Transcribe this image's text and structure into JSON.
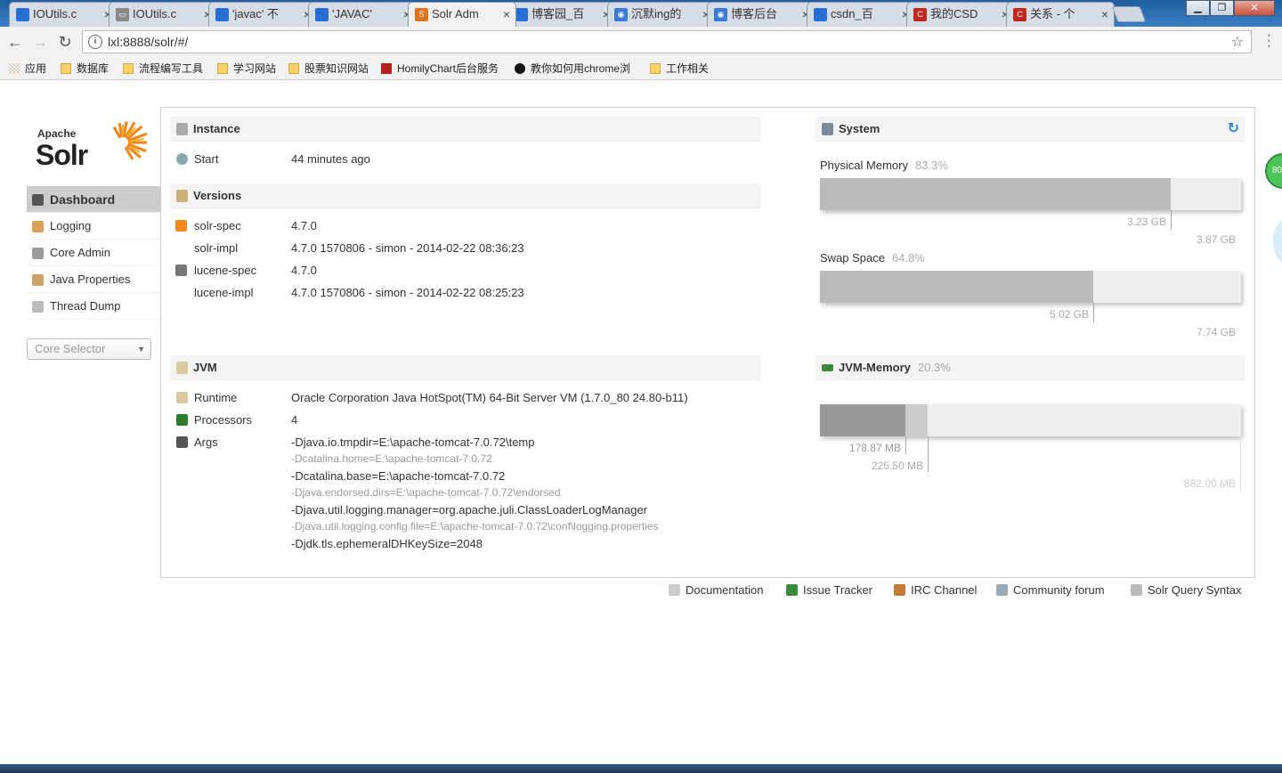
{
  "browser": {
    "tabs": [
      {
        "label": "IOUtils.c",
        "color": "#2a6fd6",
        "glyph": "🐾"
      },
      {
        "label": "IOUtils.c",
        "color": "#888888",
        "glyph": "▭"
      },
      {
        "label": "'javac' 不",
        "color": "#2a6fd6",
        "glyph": "🐾"
      },
      {
        "label": "'JAVAC'",
        "color": "#2a6fd6",
        "glyph": "🐾"
      },
      {
        "label": "Solr Adm",
        "color": "#e0741a",
        "glyph": "S"
      },
      {
        "label": "博客园_百",
        "color": "#2a6fd6",
        "glyph": "🐾"
      },
      {
        "label": "沉默ing的",
        "color": "#3a7bd5",
        "glyph": "◉"
      },
      {
        "label": "博客后台",
        "color": "#3a7bd5",
        "glyph": "◉"
      },
      {
        "label": "csdn_百",
        "color": "#2a6fd6",
        "glyph": "🐾"
      },
      {
        "label": "我的CSD",
        "color": "#c0281e",
        "glyph": "C"
      },
      {
        "label": "关系 - 个",
        "color": "#c0281e",
        "glyph": "C"
      }
    ],
    "tab_close": "×",
    "window_buttons": [
      "▁",
      "❐",
      "✕"
    ],
    "address": "lxl:8888/solr/#/",
    "info_glyph": "i",
    "star_glyph": "☆",
    "bookmarks": [
      {
        "label": "应用",
        "icon": "apps"
      },
      {
        "label": "数据库",
        "icon": "folder"
      },
      {
        "label": "流程编写工具",
        "icon": "folder"
      },
      {
        "label": "学习网站",
        "icon": "folder"
      },
      {
        "label": "股票知识网站",
        "icon": "folder"
      },
      {
        "label": "HomilyChart后台服务",
        "icon": "red"
      },
      {
        "label": "教你如何用chrome浏",
        "icon": "cblack"
      },
      {
        "label": "工作相关",
        "icon": "folder"
      }
    ]
  },
  "logo": {
    "apache": "Apache",
    "solr": "Solr"
  },
  "nav": [
    {
      "label": "Dashboard",
      "color": "#555555"
    },
    {
      "label": "Logging",
      "color": "#d9a05b"
    },
    {
      "label": "Core Admin",
      "color": "#9a9a9a"
    },
    {
      "label": "Java Properties",
      "color": "#c9a36a"
    },
    {
      "label": "Thread Dump",
      "color": "#bbbbbb"
    }
  ],
  "core_selector": {
    "placeholder": "Core Selector",
    "caret": "▼"
  },
  "instance": {
    "title": "Instance",
    "start_label": "Start",
    "start_value": "44 minutes ago"
  },
  "versions": {
    "title": "Versions",
    "rows": [
      {
        "label": "solr-spec",
        "value": "4.7.0"
      },
      {
        "label": "solr-impl",
        "value": "4.7.0 1570806 - simon - 2014-02-22 08:36:23"
      },
      {
        "label": "lucene-spec",
        "value": "4.7.0"
      },
      {
        "label": "lucene-impl",
        "value": "4.7.0 1570806 - simon - 2014-02-22 08:25:23"
      }
    ]
  },
  "jvm": {
    "title": "JVM",
    "runtime_label": "Runtime",
    "runtime_value": "Oracle Corporation Java HotSpot(TM) 64-Bit Server VM (1.7.0_80 24.80-b11)",
    "processors_label": "Processors",
    "processors_value": "4",
    "args_label": "Args",
    "args": [
      {
        "text": "-Djava.io.tmpdir=E:\\apache-tomcat-7.0.72\\temp",
        "dim": false
      },
      {
        "text": "-Dcatalina.home=E:\\apache-tomcat-7.0.72",
        "dim": true
      },
      {
        "text": "-Dcatalina.base=E:\\apache-tomcat-7.0.72",
        "dim": false
      },
      {
        "text": "-Djava.endorsed.dirs=E:\\apache-tomcat-7.0.72\\endorsed",
        "dim": true
      },
      {
        "text": "-Djava.util.logging.manager=org.apache.juli.ClassLoaderLogManager",
        "dim": false
      },
      {
        "text": "-Djava.util.logging.config.file=E:\\apache-tomcat-7.0.72\\conf\\logging.properties",
        "dim": true
      },
      {
        "text": "-Djdk.tls.ephemeralDHKeySize=2048",
        "dim": false
      }
    ]
  },
  "system": {
    "title": "System",
    "refresh_glyph": "↻",
    "physical": {
      "label": "Physical Memory",
      "percent": "83.3%",
      "used": "3.23 GB",
      "total": "3.87 GB",
      "fraction": 0.833
    },
    "swap": {
      "label": "Swap Space",
      "percent": "64.8%",
      "used": "5.02 GB",
      "total": "7.74 GB",
      "fraction": 0.648
    }
  },
  "jvm_memory": {
    "title": "JVM-Memory",
    "percent": "20.3%",
    "used": "178.87 MB",
    "committed": "225.50 MB",
    "max": "882.00 MB",
    "used_fraction": 0.203,
    "committed_fraction": 0.256
  },
  "footer": [
    {
      "label": "Documentation",
      "color": "#cccccc"
    },
    {
      "label": "Issue Tracker",
      "color": "#3a8a3a"
    },
    {
      "label": "IRC Channel",
      "color": "#c07a3a"
    },
    {
      "label": "Community forum",
      "color": "#9ab"
    },
    {
      "label": "Solr Query Syntax",
      "color": "#bbbbbb"
    }
  ],
  "edge_badge": "80"
}
